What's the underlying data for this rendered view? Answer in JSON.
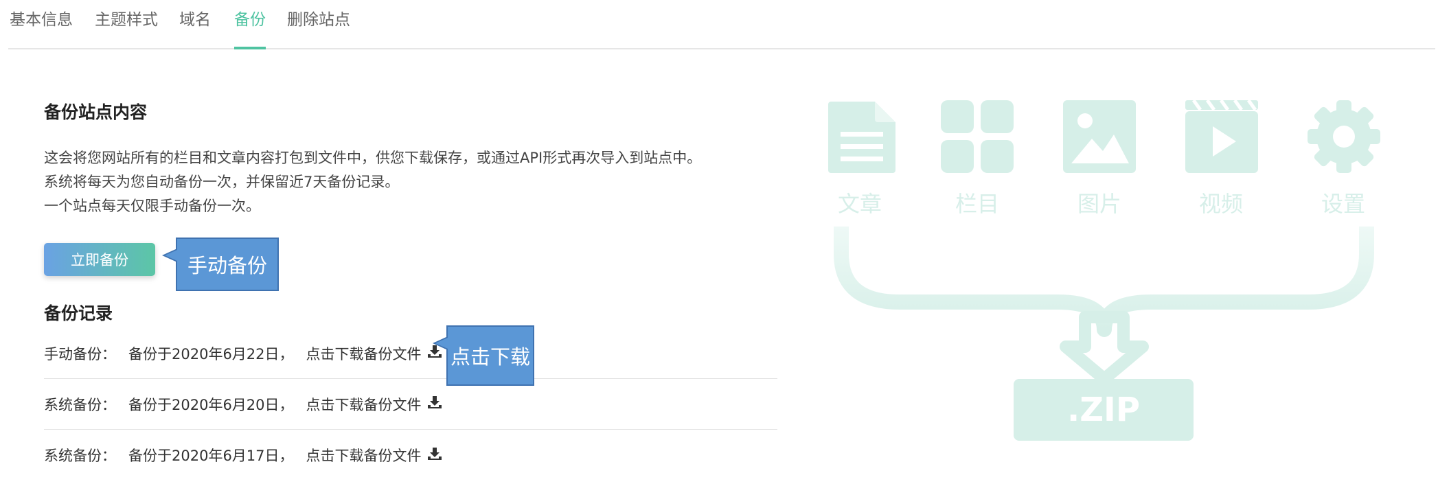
{
  "tabs": [
    {
      "label": "基本信息",
      "active": false
    },
    {
      "label": "主题样式",
      "active": false
    },
    {
      "label": "域名",
      "active": false
    },
    {
      "label": "备份",
      "active": true
    },
    {
      "label": "删除站点",
      "active": false
    }
  ],
  "backup_section": {
    "title": "备份站点内容",
    "desc_lines": [
      "这会将您网站所有的栏目和文章内容打包到文件中，供您下载保存，或通过API形式再次导入到站点中。",
      "系统将每天为您自动备份一次，并保留近7天备份记录。",
      "一个站点每天仅限手动备份一次。"
    ],
    "button_label": "立即备份",
    "button_callout": "手动备份"
  },
  "records_section": {
    "title": "备份记录",
    "download_callout": "点击下载",
    "records": [
      {
        "type": "手动备份：",
        "date": "备份于2020年6月22日，",
        "link": "点击下载备份文件"
      },
      {
        "type": "系统备份：",
        "date": "备份于2020年6月20日，",
        "link": "点击下载备份文件"
      },
      {
        "type": "系统备份：",
        "date": "备份于2020年6月17日，",
        "link": "点击下载备份文件"
      }
    ]
  },
  "illustration": {
    "items": [
      {
        "label": "文章",
        "icon": "document-icon"
      },
      {
        "label": "栏目",
        "icon": "grid-icon"
      },
      {
        "label": "图片",
        "icon": "image-icon"
      },
      {
        "label": "视频",
        "icon": "video-icon"
      },
      {
        "label": "设置",
        "icon": "gear-icon"
      }
    ],
    "zip_label": ".ZIP"
  },
  "colors": {
    "accent": "#4fc3a1",
    "callout": "#5b97d6",
    "illustration": "#d6efe8"
  }
}
